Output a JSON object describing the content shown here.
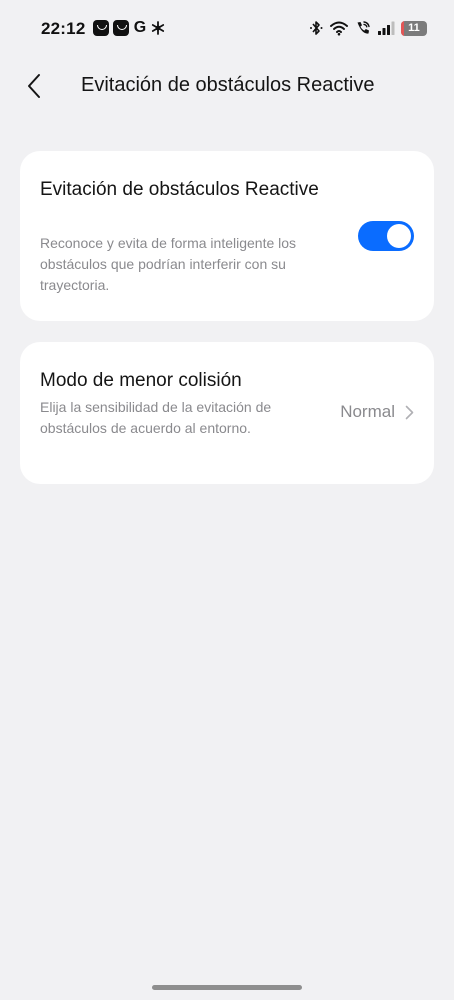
{
  "status_bar": {
    "time": "22:12",
    "battery_level": "11",
    "battery_fraction": 0.11,
    "left_icons": [
      "app-smile-icon",
      "app-smile-icon",
      "g-app-icon",
      "snowflake-icon"
    ],
    "right_icons": [
      "bluetooth-icon",
      "wifi-icon",
      "wifi-calling-icon",
      "signal-icon",
      "battery-icon"
    ]
  },
  "header": {
    "back_icon": "chevron-left-icon",
    "title": "Evitación de obstáculos Reactive"
  },
  "settings": {
    "reactive": {
      "title": "Evitación de obstáculos Reactive",
      "description": "Reconoce y evita de forma inteligente los obstáculos que podrían interferir con su trayectoria.",
      "enabled": true
    },
    "collision_mode": {
      "title": "Modo de menor colisión",
      "description": "Elija la sensibilidad de la evitación de obstáculos de acuerdo al entorno.",
      "value": "Normal"
    }
  },
  "colors": {
    "accent": "#0a6cff",
    "background": "#f1f1f3",
    "card": "#ffffff",
    "secondary_text": "#8a8a8e",
    "battery_low": "#e25656"
  }
}
